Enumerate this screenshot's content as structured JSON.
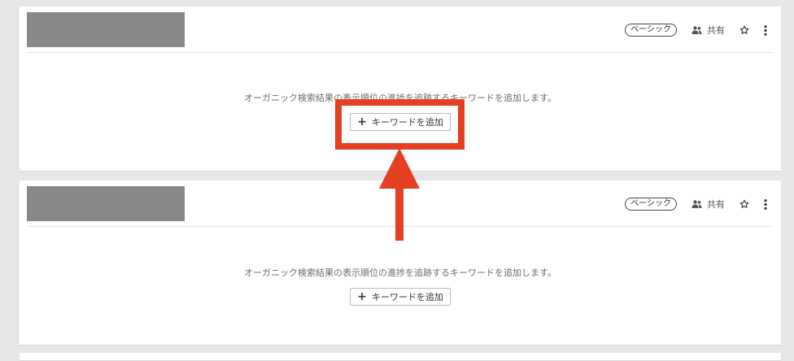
{
  "cards": [
    {
      "badge": "ベーシック",
      "share_label": "共有",
      "message": "オーガニック検索結果の表示順位の進捗を追跡するキーワードを追加します。",
      "add_button": "キーワードを追加"
    },
    {
      "badge": "ベーシック",
      "share_label": "共有",
      "message": "オーガニック検索結果の表示順位の進捗を追跡するキーワードを追加します。",
      "add_button": "キーワードを追加"
    }
  ],
  "icons": {
    "share": "people-icon",
    "star": "star-outline-icon",
    "more": "more-vertical-icon",
    "plus": "plus-icon"
  },
  "colors": {
    "background": "#e6e7e9",
    "card": "#ffffff",
    "placeholder": "#888888",
    "annotation": "#e54021"
  }
}
